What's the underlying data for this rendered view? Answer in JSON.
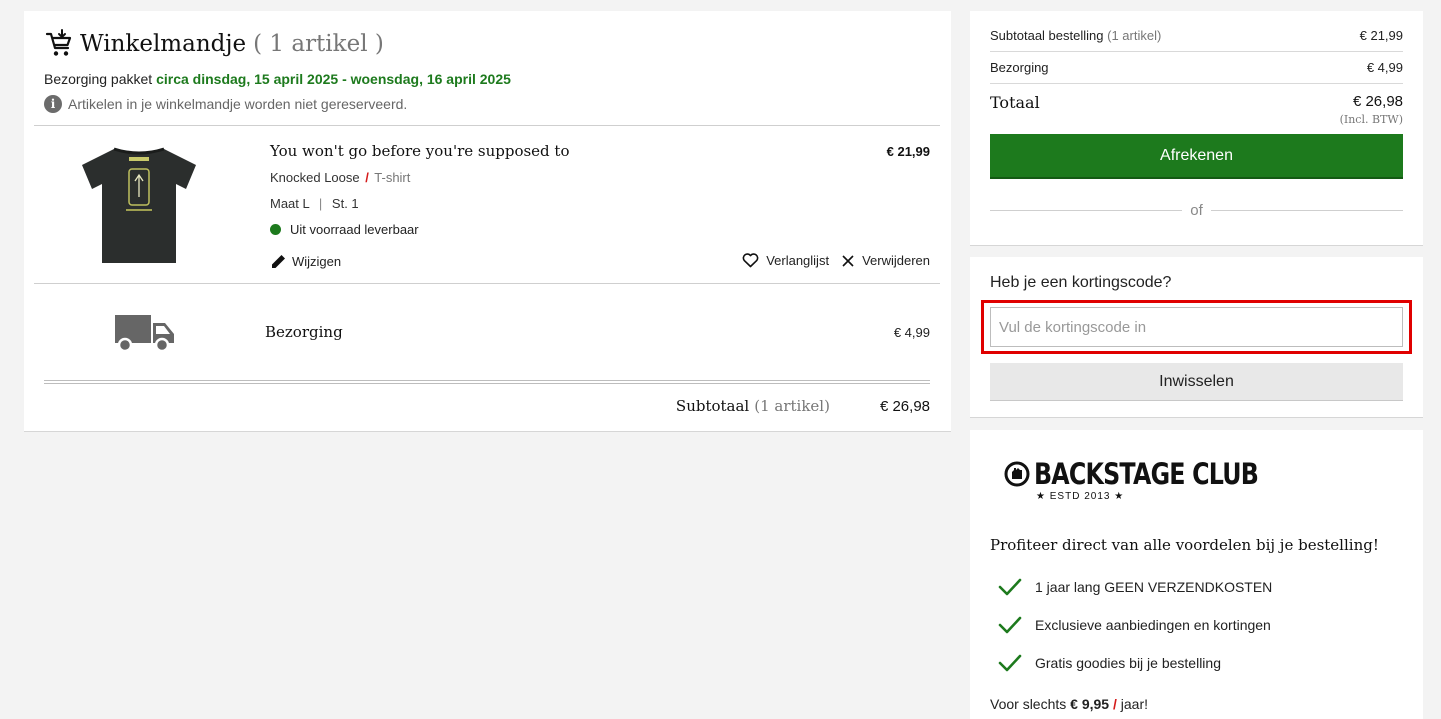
{
  "cart": {
    "title": "Winkelmandje",
    "count": "( 1 artikel )",
    "delivery_prefix": "Bezorging pakket",
    "delivery_dates": "circa dinsdag, 15 april 2025 - woensdag, 16 april 2025",
    "info_icon_glyph": "i",
    "info_text": "Artikelen in je winkelmandje worden niet gereserveerd.",
    "item": {
      "name": "You won't go before you're supposed to",
      "price": "€ 21,99",
      "band": "Knocked Loose",
      "sep": "/",
      "type": "T-shirt",
      "size": "Maat L",
      "size_sep": "|",
      "qty": "St. 1",
      "stock": "Uit voorraad leverbaar",
      "edit_label": "Wijzigen",
      "wishlist_label": "Verlanglijst",
      "remove_label": "Verwijderen"
    },
    "shipping": {
      "label": "Bezorging",
      "price": "€ 4,99"
    },
    "subtotal": {
      "label": "Subtotaal",
      "count": "(1 artikel)",
      "amount": "€ 26,98"
    }
  },
  "summary": {
    "subtotal_label": "Subtotaal bestelling",
    "subtotal_count": "(1 artikel)",
    "subtotal_amount": "€ 21,99",
    "shipping_label": "Bezorging",
    "shipping_amount": "€ 4,99",
    "total_label": "Totaal",
    "total_amount": "€ 26,98",
    "incl": "(Incl. BTW)",
    "checkout_label": "Afrekenen",
    "or_label": "of"
  },
  "discount": {
    "title": "Heb je een kortingscode?",
    "placeholder": "Vul de kortingscode in",
    "button_label": "Inwisselen"
  },
  "club": {
    "name": "BACKSTAGE CLUB",
    "est": "★ ESTD 2013 ★",
    "headline": "Profiteer direct van alle voordelen bij je bestelling!",
    "benefits": [
      "1 jaar lang GEEN VERZENDKOSTEN",
      "Exclusieve aanbiedingen en kortingen",
      "Gratis goodies bij je bestelling"
    ],
    "price_prefix": "Voor slechts",
    "price": "€ 9,95",
    "price_sep": "/",
    "price_suffix": "jaar!"
  },
  "colors": {
    "accent_green": "#1d7a1d",
    "highlight_red": "#e00000",
    "slash_red": "#d51b1b"
  },
  "icons": [
    "cart-icon",
    "info-icon",
    "pencil-icon",
    "heart-icon",
    "close-icon",
    "truck-icon",
    "check-icon",
    "club-logo-icon"
  ]
}
